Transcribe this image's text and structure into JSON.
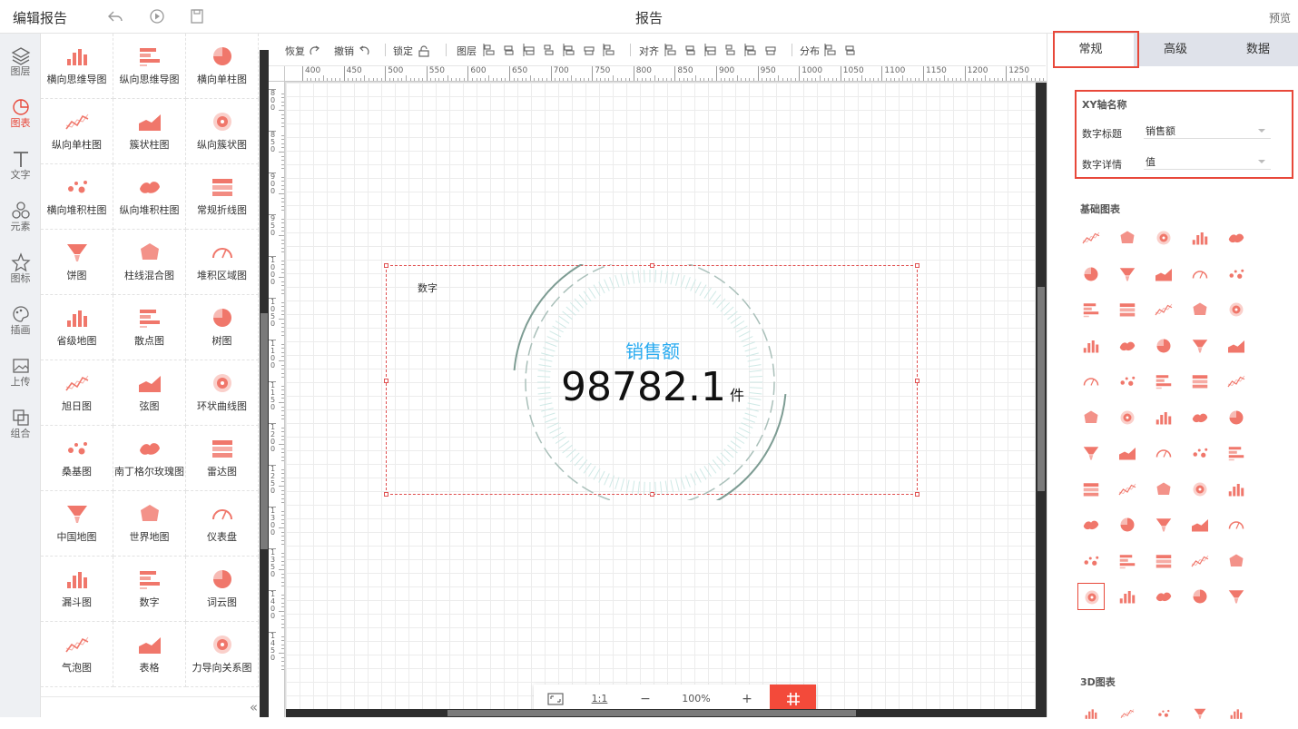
{
  "header": {
    "title": "编辑报告",
    "report_name": "报告",
    "preview": "预览",
    "icons": [
      "undo-icon",
      "play-icon",
      "save-icon"
    ]
  },
  "left_nav": [
    {
      "label": "图层",
      "icon": "layers-icon",
      "active": false
    },
    {
      "label": "图表",
      "icon": "chart-icon",
      "active": true
    },
    {
      "label": "文字",
      "icon": "text-icon",
      "active": false
    },
    {
      "label": "元素",
      "icon": "elements-icon",
      "active": false
    },
    {
      "label": "图标",
      "icon": "star-icon",
      "active": false
    },
    {
      "label": "插画",
      "icon": "palette-icon",
      "active": false
    },
    {
      "label": "上传",
      "icon": "upload-image-icon",
      "active": false
    },
    {
      "label": "组合",
      "icon": "group-icon",
      "active": false
    }
  ],
  "gallery": [
    "横向思维导图",
    "纵向思维导图",
    "横向单柱图",
    "纵向单柱图",
    "簇状柱图",
    "纵向簇状图",
    "横向堆积柱图",
    "纵向堆积柱图",
    "常规折线图",
    "饼图",
    "柱线混合图",
    "堆积区域图",
    "省级地图",
    "散点图",
    "树图",
    "旭日图",
    "弦图",
    "环状曲线图",
    "桑基图",
    "南丁格尔玫瑰图",
    "雷达图",
    "中国地图",
    "世界地图",
    "仪表盘",
    "漏斗图",
    "数字",
    "词云图",
    "气泡图",
    "表格",
    "力导向关系图"
  ],
  "toolbar": {
    "restore": "恢复",
    "undo": "撤销",
    "lock": "锁定",
    "layer": "图层",
    "align": "对齐",
    "distribute": "分布"
  },
  "ruler": {
    "x_ticks": [
      "400",
      "450",
      "500",
      "550",
      "600",
      "650",
      "700",
      "750",
      "800",
      "850",
      "900",
      "950",
      "1000",
      "1050",
      "1100",
      "1150",
      "1200",
      "1250"
    ],
    "y_ticks": [
      "800",
      "850",
      "900",
      "950",
      "1000",
      "1050",
      "1100",
      "1150",
      "1200",
      "1250",
      "1300",
      "1350",
      "1400",
      "1450"
    ]
  },
  "widget": {
    "label": "数字",
    "title": "销售额",
    "value": "98782.1",
    "unit": "件"
  },
  "zoom": {
    "fit_icon": "fit-screen-icon",
    "ratio": "1:1",
    "minus": "−",
    "level": "100%",
    "plus": "+",
    "grid_icon": "grid-icon"
  },
  "right_panel": {
    "tabs": [
      "常规",
      "高级",
      "数据"
    ],
    "active_tab": "常规",
    "xy_section": "XY轴名称",
    "fields": [
      {
        "label": "数字标题",
        "value": "销售额"
      },
      {
        "label": "数字详情",
        "value": "值"
      }
    ],
    "basic_section": "基础图表",
    "section_3d": "3D图表"
  },
  "colors": {
    "accent": "#e8483a",
    "chart_icon": "#f0776b",
    "title_blue": "#2aabf0",
    "ring": "#7d9c93",
    "tab_bg": "#dfe2ea"
  }
}
